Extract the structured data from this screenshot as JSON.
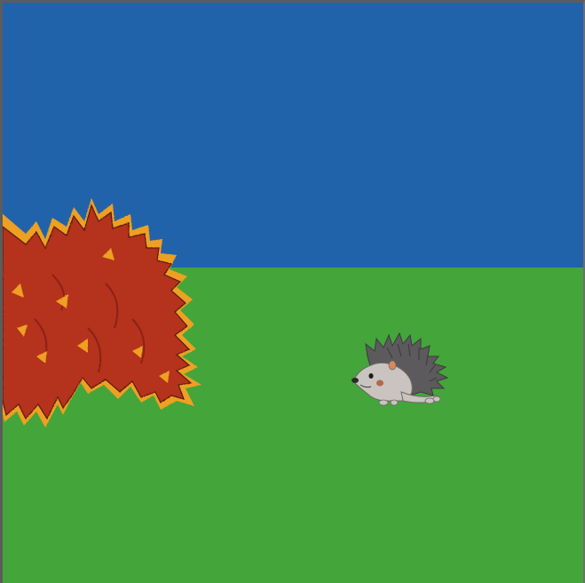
{
  "scene": {
    "colors": {
      "sky": "#2163ab",
      "ground": "#43a53a",
      "bush_fill": "#b5321e",
      "bush_edge": "#f0a020",
      "hedgehog_body": "#c9c4bf",
      "hedgehog_spines": "#5c5a5c"
    },
    "sprites": [
      {
        "name": "autumn-bush",
        "kind": "decoration"
      },
      {
        "name": "hedgehog",
        "kind": "character"
      }
    ]
  }
}
